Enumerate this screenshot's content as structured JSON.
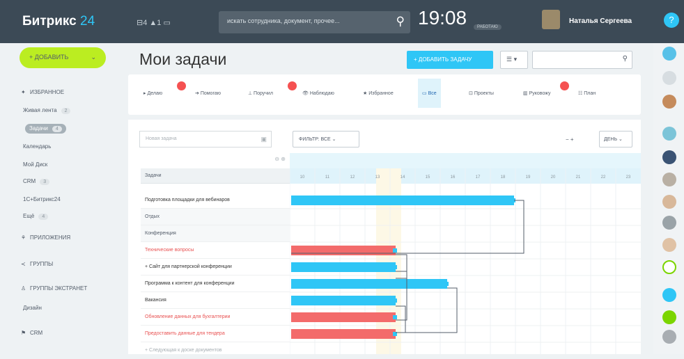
{
  "header": {
    "logo_main": "Битрикс",
    "logo_accent": "24",
    "status_icons": "⊟4 ▲1 ▭",
    "search_placeholder": "искать сотрудника, документ, прочее...",
    "time": "19:08",
    "work_status": "РАБОТАЮ",
    "user_name": "Наталья Сергеева",
    "help_icon": "?"
  },
  "sidebar": {
    "add_button": "+ ДОБАВИТЬ",
    "items": [
      {
        "label": "ИЗБРАННОЕ",
        "type": "main"
      },
      {
        "label": "Живая лента",
        "count": "2"
      },
      {
        "label": "Задачи",
        "count": "4",
        "active": true
      },
      {
        "label": "Календарь"
      },
      {
        "label": "Мой Диск"
      },
      {
        "label": "CRM",
        "count": "3"
      },
      {
        "label": "1С+Битрикс24"
      },
      {
        "label": "Ещё",
        "count": "4"
      },
      {
        "label": "ПРИЛОЖЕНИЯ",
        "type": "main"
      },
      {
        "label": "ГРУППЫ",
        "type": "main"
      },
      {
        "label": "ГРУППЫ ЭКСТРАНЕТ",
        "type": "main"
      },
      {
        "label": "Дизайн"
      },
      {
        "label": "CRM",
        "type": "main"
      }
    ]
  },
  "main": {
    "title": "Мои задачи",
    "add_task": "+ ДОБАВИТЬ ЗАДАЧУ",
    "view_select": "☰ ▾",
    "tabs": [
      {
        "label": "Делаю",
        "badge": true
      },
      {
        "label": "Помогаю"
      },
      {
        "label": "Поручил",
        "badge": true
      },
      {
        "label": "Наблюдаю"
      },
      {
        "label": "Избранное"
      },
      {
        "label": "Все",
        "active": true
      },
      {
        "label": "Проекты"
      },
      {
        "label": "Руковожу",
        "badge": true
      },
      {
        "label": "План"
      }
    ],
    "new_task_placeholder": "Новая задача",
    "filter_label": "ФИЛЬТР: ВСЕ",
    "zoom": "−  +",
    "scale_label": "ДЕНЬ",
    "column_header": "Задачи",
    "days": [
      "10",
      "11",
      "12",
      "13",
      "14",
      "15",
      "16",
      "17",
      "18",
      "19",
      "20",
      "21",
      "22",
      "23"
    ],
    "tasks": [
      {
        "label": "Подготовка площадки для вебинаров",
        "style": "normal"
      },
      {
        "label": "Отдых",
        "style": "project"
      },
      {
        "label": "Конференция",
        "style": "project"
      },
      {
        "label": "Технические вопросы",
        "style": "red"
      },
      {
        "label": "+ Сайт для партнерской конференции",
        "style": "normal"
      },
      {
        "label": "Программа к контент для конференции",
        "style": "normal"
      },
      {
        "label": "Вакансия",
        "style": "normal"
      },
      {
        "label": "Обновление данных для бухгалтерии",
        "style": "red"
      },
      {
        "label": "Предоставить данные для тендера",
        "style": "red"
      },
      {
        "label": "+ Следующая к доске документов",
        "style": "new"
      }
    ]
  },
  "colors": {
    "accent": "#2fc6f6",
    "add": "#bbed21",
    "red": "#f36b6b",
    "bar": "#2fc6f6"
  }
}
